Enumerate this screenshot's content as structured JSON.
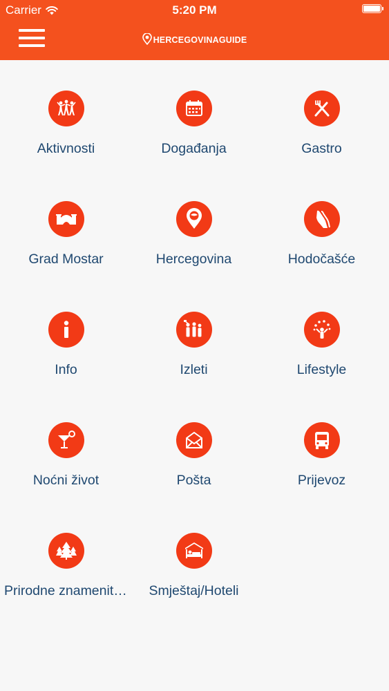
{
  "status_bar": {
    "carrier": "Carrier",
    "time": "5:20 PM"
  },
  "header": {
    "brand": "HERCEGOVINAGUIDE"
  },
  "colors": {
    "accent": "#f4511e",
    "icon_circle": "#f23a16",
    "label": "#1f4870",
    "background": "#f7f7f7"
  },
  "categories": [
    {
      "label": "Aktivnosti",
      "icon": "people-dancing-icon"
    },
    {
      "label": "Događanja",
      "icon": "calendar-icon"
    },
    {
      "label": "Gastro",
      "icon": "fork-knife-icon"
    },
    {
      "label": "Grad Mostar",
      "icon": "bridge-icon"
    },
    {
      "label": "Hercegovina",
      "icon": "map-pin-icon"
    },
    {
      "label": "Hodočašće",
      "icon": "praying-hands-icon"
    },
    {
      "label": "Info",
      "icon": "info-icon"
    },
    {
      "label": "Izleti",
      "icon": "group-tour-icon"
    },
    {
      "label": "Lifestyle",
      "icon": "juggler-icon"
    },
    {
      "label": "Noćni život",
      "icon": "cocktail-icon"
    },
    {
      "label": "Pošta",
      "icon": "mail-envelope-icon"
    },
    {
      "label": "Prijevoz",
      "icon": "bus-icon"
    },
    {
      "label": "Prirodne znamenitosti",
      "icon": "trees-icon"
    },
    {
      "label": "Smještaj/Hoteli",
      "icon": "bed-icon"
    }
  ]
}
